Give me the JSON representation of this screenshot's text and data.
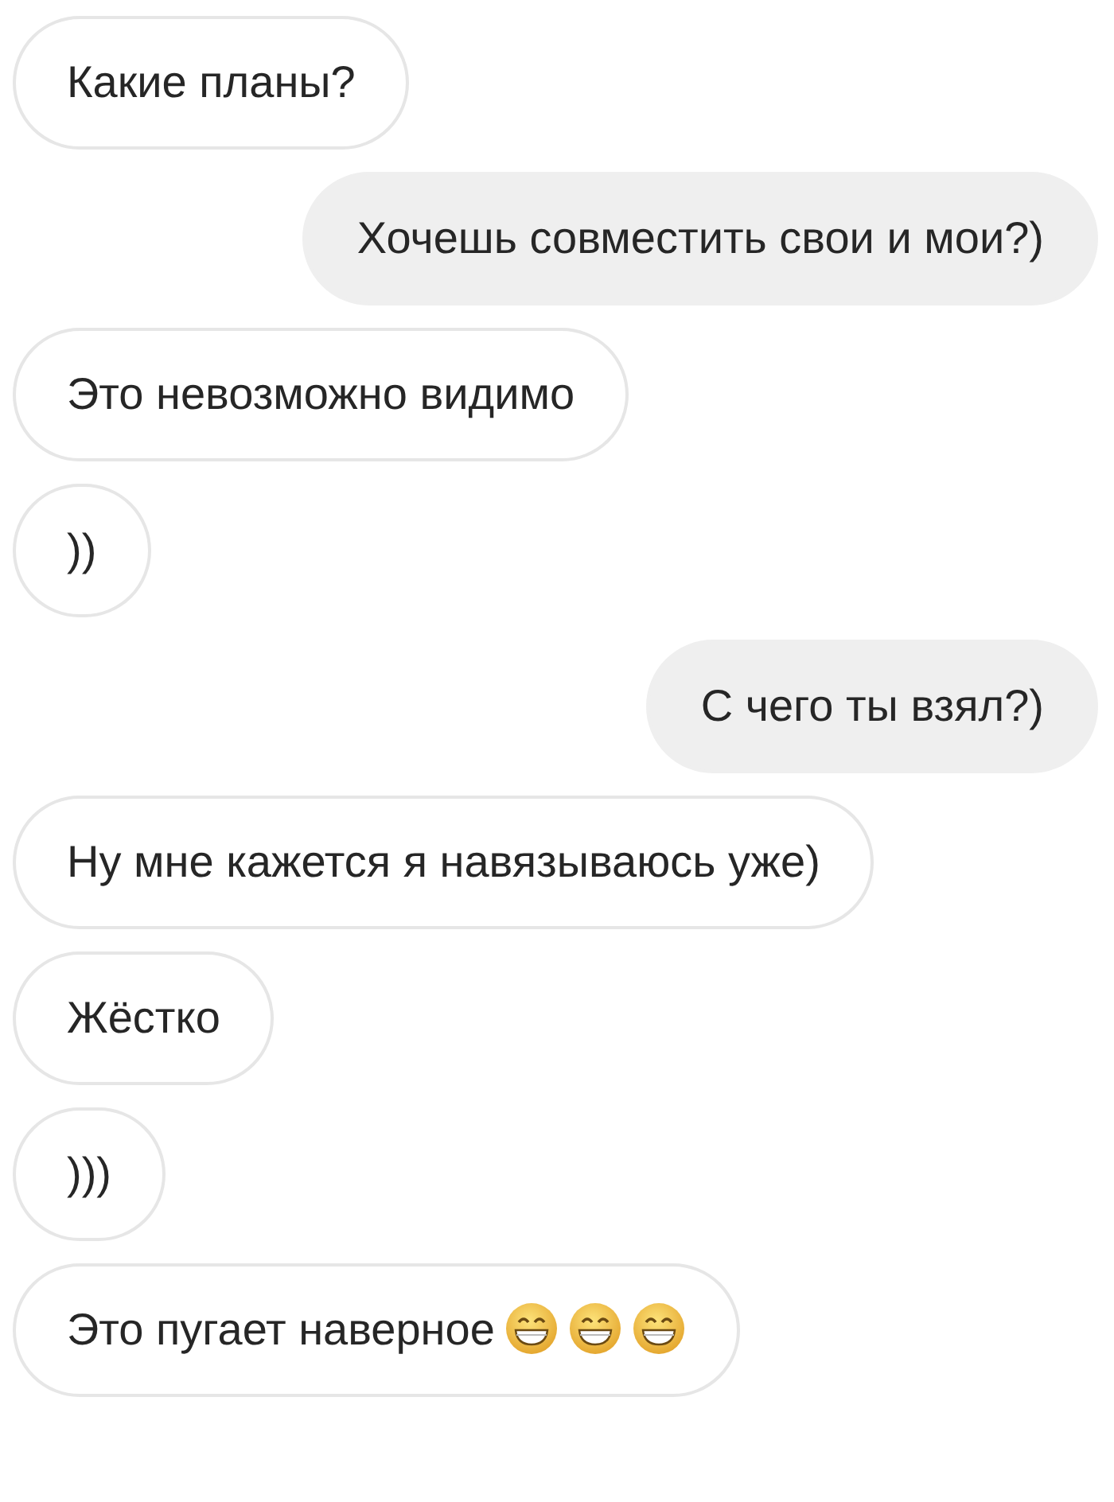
{
  "messages": [
    {
      "outgoing": false,
      "text": "Какие планы?"
    },
    {
      "outgoing": true,
      "text": "Хочешь совместить свои и мои?)"
    },
    {
      "outgoing": false,
      "text": "Это невозможно видимо"
    },
    {
      "outgoing": false,
      "text": "))"
    },
    {
      "outgoing": true,
      "text": "С чего ты взял?)"
    },
    {
      "outgoing": false,
      "text": "Ну мне кажется я навязываюсь уже)"
    },
    {
      "outgoing": false,
      "text": "Жёстко"
    },
    {
      "outgoing": false,
      "text": ")))"
    },
    {
      "outgoing": false,
      "text": "Это пугает наверное",
      "icons": [
        {
          "kind": "grin"
        },
        {
          "kind": "grin"
        },
        {
          "kind": "grin"
        }
      ]
    }
  ]
}
